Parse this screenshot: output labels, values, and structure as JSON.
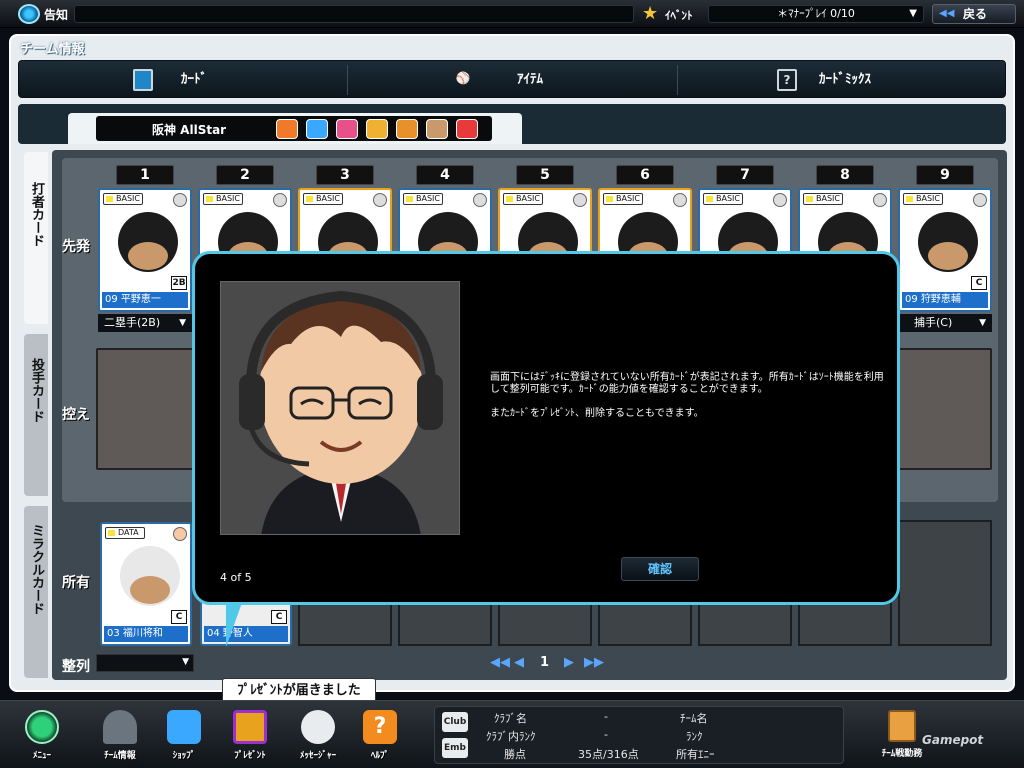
{
  "topbar": {
    "notice_label": "告知",
    "event_label": "ｲﾍﾞﾝﾄ",
    "event_value": "＊ﾏﾅｰﾌﾟﾚｲ 0/10",
    "back_label": "戻る"
  },
  "page": {
    "title": "チーム情報"
  },
  "tabs": [
    {
      "label": "ｶｰﾄﾞ",
      "icon": "card-icon"
    },
    {
      "label": "ｱｲﾃﾑ",
      "icon": "bat-ball-icon"
    },
    {
      "label": "ｶｰﾄﾞﾐｯｸｽ",
      "icon": "question-card-icon"
    }
  ],
  "team": {
    "name": "阪神 AllStar",
    "skill_icons": [
      "bat-skill-icon",
      "glove-skill-icon",
      "pitch-skill-icon",
      "runner-skill-icon",
      "power-skill-icon",
      "face-skill-icon",
      "ball-skill-icon"
    ]
  },
  "side_tabs": [
    {
      "label": "打者カード"
    },
    {
      "label": "投手カード"
    },
    {
      "label": "ミラクルカード"
    }
  ],
  "rows": {
    "starter": "先発",
    "bench": "控え",
    "owned": "所有",
    "sort": "整列"
  },
  "lineup": {
    "numbers": [
      "1",
      "2",
      "3",
      "4",
      "5",
      "6",
      "7",
      "8",
      "9"
    ],
    "card_grade": "BASIC",
    "first_card": {
      "name": "09 平野恵一",
      "pos": "2B",
      "select": "二塁手(2B)"
    },
    "last_card": {
      "name": "09 狩野恵輔",
      "pos": "C",
      "select": "捕手(C)"
    }
  },
  "owned": {
    "cards": [
      {
        "grade": "DATA",
        "name": "03 福川将和",
        "pos": "C"
      },
      {
        "name": "04 野智人",
        "pos": "C"
      }
    ]
  },
  "pager": {
    "first": "◀◀",
    "prev": "◀",
    "page": "1",
    "next": "▶",
    "last": "▶▶"
  },
  "modal": {
    "text1": "画面下にはﾃﾞｯｷに登録されていない所有ｶｰﾄﾞが表記されます。所有ｶｰﾄﾞはｿｰﾄ機能を利用して整列可能です。ｶｰﾄﾞの能力値を確認することができます。",
    "text2": "またｶｰﾄﾞをﾌﾟﾚｾﾞﾝﾄ、削除することもできます。",
    "page_indicator": "4 of 5",
    "confirm_label": "確認"
  },
  "tooltip": "ﾌﾟﾚｾﾞﾝﾄが届きました",
  "bottom_nav": [
    {
      "label": "ﾒﾆｭｰ",
      "icon": "menu-play-icon",
      "color": "#2fd07a"
    },
    {
      "label": "ﾁｰﾑ情報",
      "icon": "helmet-icon",
      "color": "#6b7580"
    },
    {
      "label": "ｼｮｯﾌﾟ",
      "icon": "shop-basket-icon",
      "color": "#3aa8ff"
    },
    {
      "label": "ﾌﾟﾚｾﾞﾝﾄ",
      "icon": "present-icon",
      "color": "#e8a21e"
    },
    {
      "label": "ﾒｯｾｰｼﾞｬｰ",
      "icon": "message-bubble-icon",
      "color": "#e9ecef"
    },
    {
      "label": "ﾍﾙﾌﾟ",
      "icon": "help-icon",
      "color": "#f48b1e"
    }
  ],
  "club": {
    "badge_club": "Club",
    "badge_emb": "Emb",
    "club_name_label": "ｸﾗﾌﾞ名",
    "club_name_value": "-",
    "club_rank_label": "ｸﾗﾌﾞ内ﾗﾝｸ",
    "club_rank_value": "-",
    "wins_label": "勝点",
    "wins_value": "35点/316点",
    "team_name_label": "ﾁｰﾑ名",
    "rank_label": "ﾗﾝｸ",
    "energy_label": "所有ｴﾆｰ"
  },
  "right_btn": "ﾁｰﾑ戦勤務",
  "logo": "Gamepot"
}
